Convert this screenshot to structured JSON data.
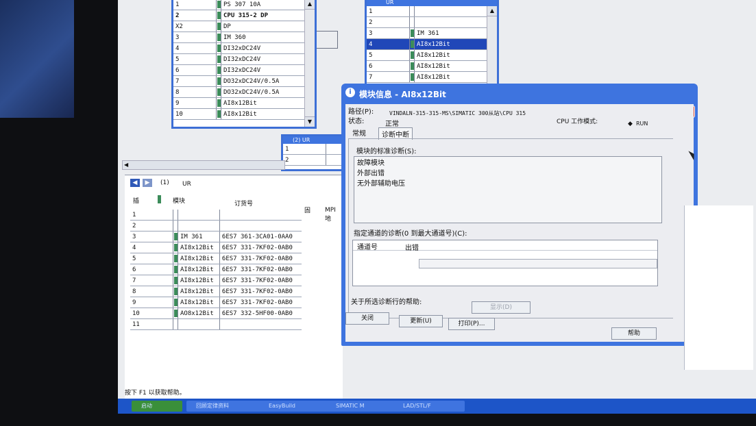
{
  "rack_top": {
    "rows": [
      {
        "slot": "1",
        "module": "PS 307 10A"
      },
      {
        "slot": "2",
        "module": "CPU 315-2 DP"
      },
      {
        "slot": "X2",
        "module": "DP"
      },
      {
        "slot": "3",
        "module": "IM 360"
      },
      {
        "slot": "4",
        "module": "DI32xDC24V"
      },
      {
        "slot": "5",
        "module": "DI32xDC24V"
      },
      {
        "slot": "6",
        "module": "DI32xDC24V"
      },
      {
        "slot": "7",
        "module": "DO32xDC24V/0.5A"
      },
      {
        "slot": "8",
        "module": "DO32xDC24V/0.5A"
      },
      {
        "slot": "9",
        "module": "AI8x12Bit"
      },
      {
        "slot": "10",
        "module": "AI8x12Bit"
      }
    ]
  },
  "rack_right": {
    "title": "UR",
    "rows": [
      {
        "slot": "1",
        "module": ""
      },
      {
        "slot": "2",
        "module": ""
      },
      {
        "slot": "3",
        "module": "IM 361"
      },
      {
        "slot": "4",
        "module": "AI8x12Bit"
      },
      {
        "slot": "5",
        "module": "AI8x12Bit"
      },
      {
        "slot": "6",
        "module": "AI8x12Bit"
      },
      {
        "slot": "7",
        "module": "AI8x12Bit"
      }
    ]
  },
  "rack_mid": {
    "title": "(2) UR",
    "rows": [
      {
        "slot": "1"
      },
      {
        "slot": "2"
      }
    ]
  },
  "bottom_panel": {
    "station_num": "(1)",
    "station_name": "UR",
    "headers": {
      "slot": "插",
      "module": "模块",
      "order": "订货号",
      "fw": "固",
      "mpi": "MPI 地"
    },
    "rows": [
      {
        "slot": "1",
        "module": "",
        "order": ""
      },
      {
        "slot": "2",
        "module": "",
        "order": ""
      },
      {
        "slot": "3",
        "module": "IM 361",
        "order": "6ES7 361-3CA01-0AA0"
      },
      {
        "slot": "4",
        "module": "AI8x12Bit",
        "order": "6ES7 331-7KF02-0AB0"
      },
      {
        "slot": "5",
        "module": "AI8x12Bit",
        "order": "6ES7 331-7KF02-0AB0"
      },
      {
        "slot": "6",
        "module": "AI8x12Bit",
        "order": "6ES7 331-7KF02-0AB0"
      },
      {
        "slot": "7",
        "module": "AI8x12Bit",
        "order": "6ES7 331-7KF02-0AB0"
      },
      {
        "slot": "8",
        "module": "AI8x12Bit",
        "order": "6ES7 331-7KF02-0AB0"
      },
      {
        "slot": "9",
        "module": "AI8x12Bit",
        "order": "6ES7 331-7KF02-0AB0"
      },
      {
        "slot": "10",
        "module": "AO8x12Bit",
        "order": "6ES7 332-5HF00-0AB0"
      },
      {
        "slot": "11",
        "module": "",
        "order": ""
      }
    ]
  },
  "status_bar": "按下 F1 以获取帮助。",
  "dialog": {
    "title": "模块信息 - AI8x12Bit",
    "path_label": "路径(P):",
    "path_value": "VINDALN-315-315-MS\\SIMATIC 300从站\\CPU 315",
    "cpu_mode_label": "CPU 工作模式:",
    "cpu_mode_value": "RUN",
    "status_label": "状态:",
    "status_value": "正常",
    "tabs": [
      "常规",
      "诊断中断"
    ],
    "std_diag_label": "模块的标准诊断(S):",
    "std_diag_items": [
      "故障模块",
      "外部出错",
      "无外部辅助电压"
    ],
    "channel_diag_label": "指定通道的诊断(0 到最大通道号)(C):",
    "channel_cols": [
      "通道号",
      "出错"
    ],
    "help_diag_label": "关于所选诊断行的帮助:",
    "btn_display": "显示(D)",
    "btn_close": "关闭",
    "btn_update": "更新(U)",
    "btn_print": "打印(P)...",
    "btn_help": "帮助"
  },
  "taskbar": {
    "items": [
      "启动",
      "回顾定律资料",
      "EasyBuild",
      "SIMATIC M",
      "LAD/STL/F"
    ]
  },
  "colors": {
    "titlebar": "#3e74df",
    "selected": "#2047b8",
    "module_mark": "#3c8c5a"
  }
}
